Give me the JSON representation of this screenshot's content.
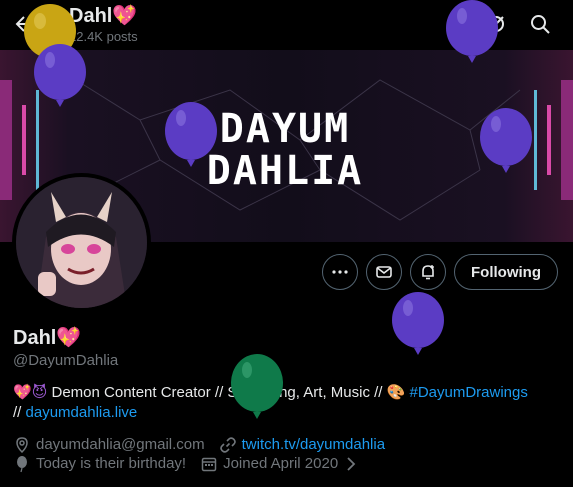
{
  "header": {
    "name": "Dahl",
    "posts": "12.4K posts"
  },
  "banner": {
    "title": "DAYUM DAHLIA"
  },
  "profile": {
    "display_name": "Dahl",
    "handle": "@DayumDahlia",
    "bio_text_1": " Demon Content Creator // Streaming, Art, Music // ",
    "bio_hashtag": "#DayumDrawings",
    "bio_slashes": "// ",
    "bio_link": "dayumdahlia.live",
    "email": "dayumdahlia@gmail.com",
    "website": "twitch.tv/dayumdahlia",
    "birthday": "Today is their birthday!",
    "joined": "Joined April 2020"
  },
  "actions": {
    "follow_label": "Following"
  },
  "colors": {
    "accent": "#1d9bf0",
    "balloon_purple": "#5b3cc4",
    "balloon_gold": "#c9a514",
    "balloon_green": "#0f7a4a"
  }
}
